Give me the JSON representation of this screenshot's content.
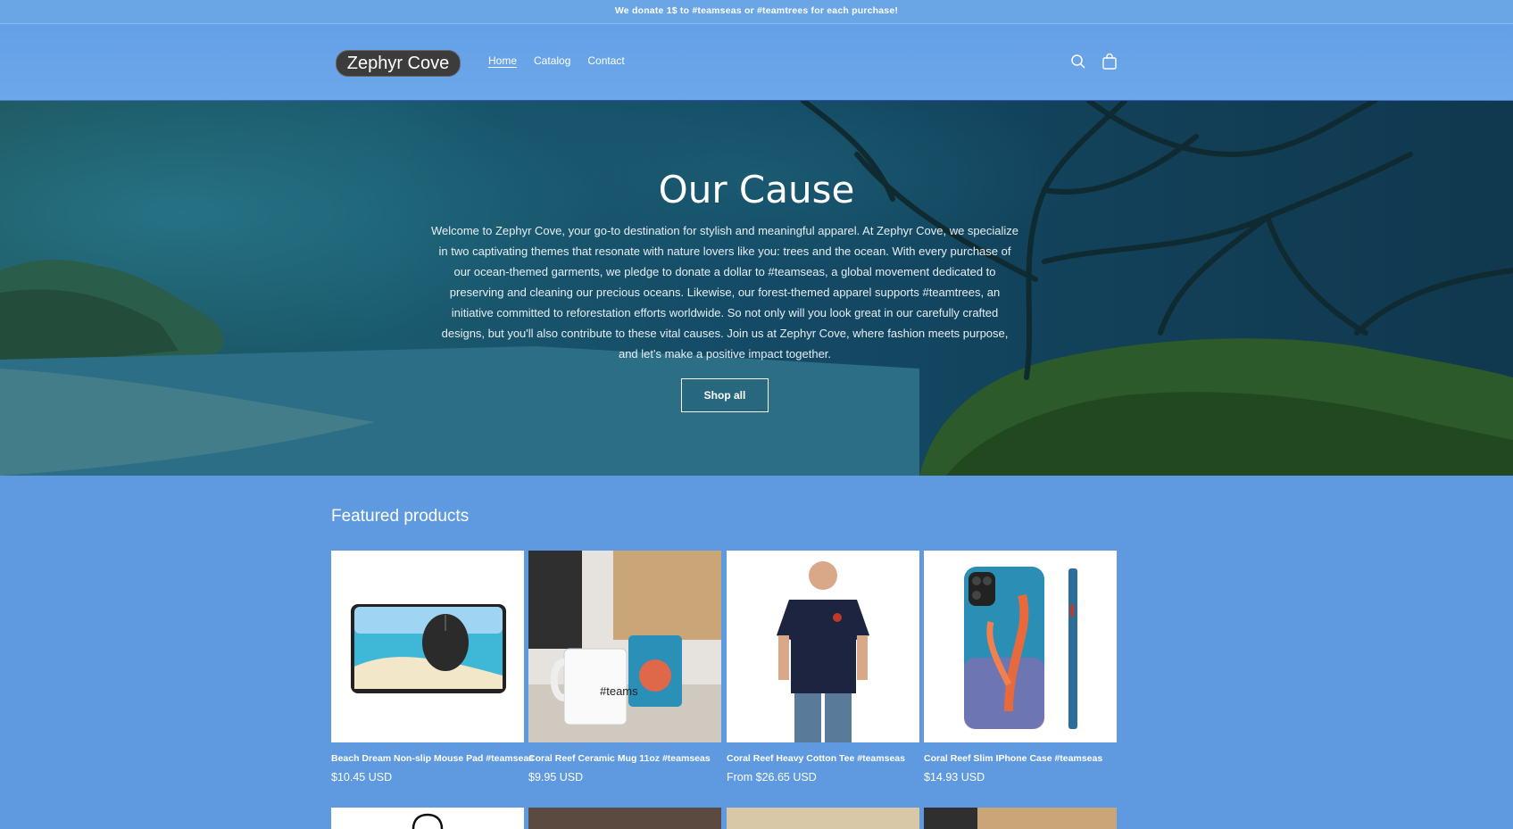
{
  "announcement": "We donate 1$ to #teamseas or #teamtrees for each purchase!",
  "header": {
    "logo_text": "Zephyr Cove",
    "nav": [
      "Home",
      "Catalog",
      "Contact"
    ],
    "search_icon": "search-icon",
    "cart_icon": "cart-icon"
  },
  "hero": {
    "title": "Our Cause",
    "text": "Welcome to Zephyr Cove, your go-to destination for stylish and meaningful apparel. At Zephyr Cove, we specialize in two captivating themes that resonate with nature lovers like you: trees and the ocean. With every purchase of our ocean-themed garments, we pledge to donate a dollar to #teamseas, a global movement dedicated to preserving and cleaning our precious oceans. Likewise, our forest-themed apparel supports #teamtrees, an initiative committed to reforestation efforts worldwide. So not only will you look great in our carefully crafted designs, but you'll also contribute to these vital causes. Join us at Zephyr Cove, where fashion meets purpose, and let's make a positive impact together.",
    "button": "Shop all"
  },
  "featured": {
    "title": "Featured products",
    "products": [
      {
        "title": "Beach Dream Non-slip Mouse Pad #teamseas",
        "price": "$10.45 USD"
      },
      {
        "title": "Coral Reef Ceramic Mug 11oz #teamseas",
        "price": "$9.95 USD"
      },
      {
        "title": "Coral Reef Heavy Cotton Tee #teamseas",
        "price": "From $26.65 USD"
      },
      {
        "title": "Coral Reef Slim IPhone Case #teamseas",
        "price": "$14.93 USD"
      }
    ],
    "mug_text": "#teams"
  }
}
